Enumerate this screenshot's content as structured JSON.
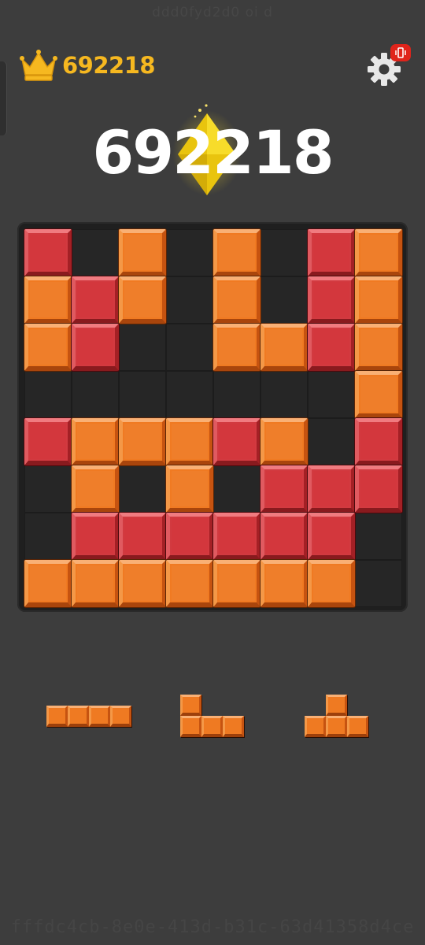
{
  "watermark_top": "ddd0fyd2d0 oi d",
  "watermark_bottom": "fffdc4cb-8e0e-413d-b31c-63d41358d4ce",
  "best_score": "692218",
  "current_score": "692218",
  "colors": {
    "background": "#3d3d3d",
    "board": "#1f1f1f",
    "orange": "#f07a22",
    "red": "#d23a40",
    "crown": "#f6b820",
    "diamond": "#f3d21a",
    "badge": "#e0241b"
  },
  "icons": {
    "best": "crown-icon",
    "settings": "gear-icon",
    "badge": "vibration-icon",
    "bonus": "diamond-icon"
  },
  "board": {
    "rows": 8,
    "cols": 8,
    "cells": [
      [
        "R",
        ".",
        "O",
        ".",
        "O",
        ".",
        "R",
        "O"
      ],
      [
        "O",
        "R",
        "O",
        ".",
        "O",
        ".",
        "R",
        "O"
      ],
      [
        "O",
        "R",
        ".",
        ".",
        "O",
        "O",
        "R",
        "O"
      ],
      [
        ".",
        ".",
        ".",
        ".",
        ".",
        ".",
        ".",
        "O"
      ],
      [
        "R",
        "O",
        "O",
        "O",
        "R",
        "O",
        ".",
        "R"
      ],
      [
        ".",
        "O",
        ".",
        "O",
        ".",
        "R",
        "R",
        "R"
      ],
      [
        ".",
        "R",
        "R",
        "R",
        "R",
        "R",
        "R",
        "."
      ],
      [
        "O",
        "O",
        "O",
        "O",
        "O",
        "O",
        "O",
        "."
      ]
    ]
  },
  "pieces": [
    {
      "name": "piece-i-horizontal",
      "shape": [
        [
          1,
          1,
          1,
          1
        ]
      ]
    },
    {
      "name": "piece-j",
      "shape": [
        [
          1,
          0,
          0
        ],
        [
          1,
          1,
          1
        ]
      ]
    },
    {
      "name": "piece-t",
      "shape": [
        [
          0,
          1,
          0
        ],
        [
          1,
          1,
          1
        ]
      ]
    }
  ]
}
